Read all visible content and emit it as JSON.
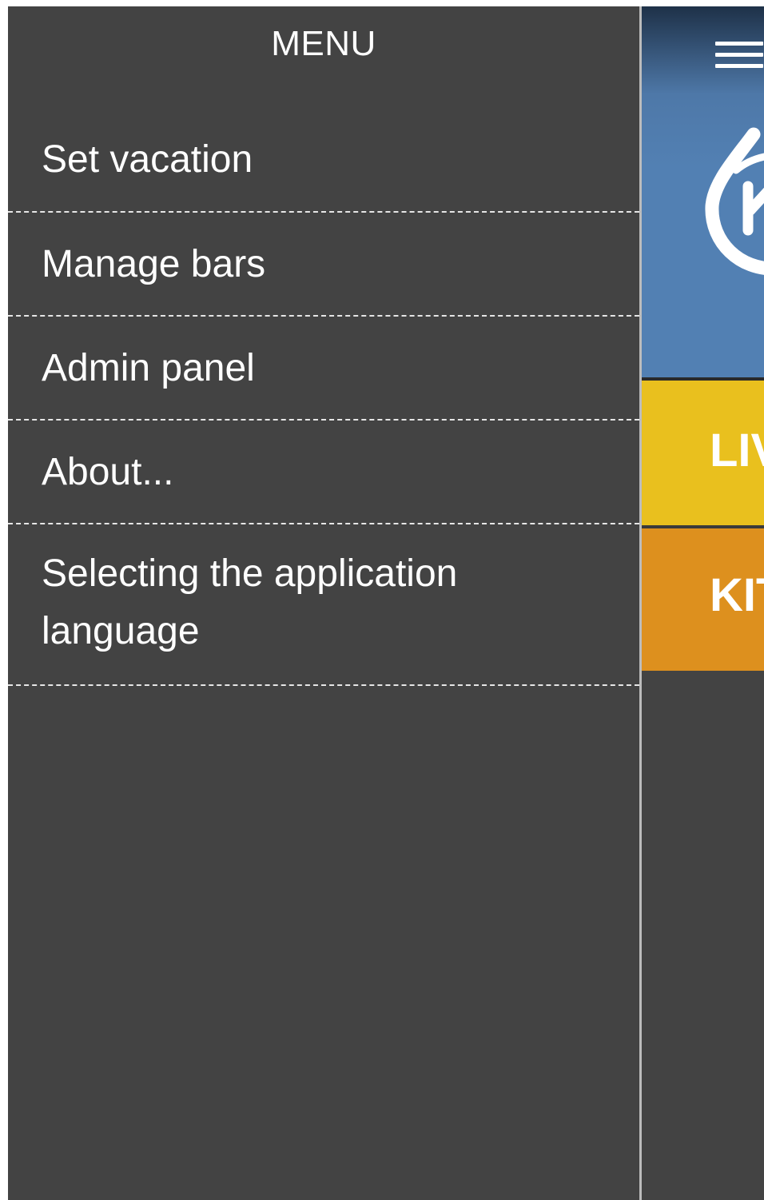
{
  "drawer": {
    "title": "MENU",
    "items": [
      {
        "label": "Set vacation"
      },
      {
        "label": "Manage bars"
      },
      {
        "label": "Admin panel"
      },
      {
        "label": "About..."
      },
      {
        "label": "Selecting the application language"
      }
    ]
  },
  "main": {
    "rooms": [
      {
        "label": "LIVING",
        "color": "#e9c01e"
      },
      {
        "label": "KITCHEN",
        "color": "#dd901e"
      }
    ],
    "header_color": "#5280b3",
    "menu_icon": "hamburger-menu-icon",
    "logo_icon": "logo-icon"
  },
  "colors": {
    "drawer_background": "#434343",
    "divider": "#bcbcbc"
  }
}
